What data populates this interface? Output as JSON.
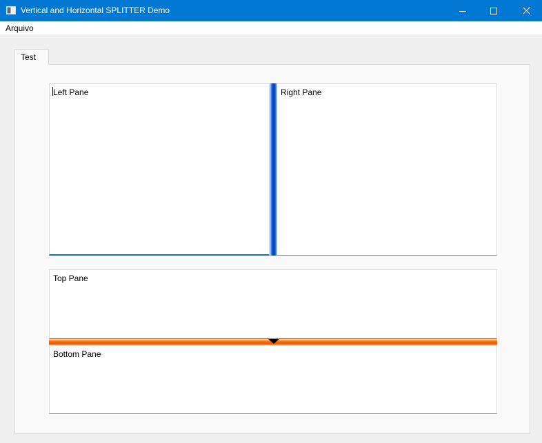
{
  "window": {
    "title": "Vertical and Horizontal SPLITTER Demo",
    "accent_color": "#0078d4",
    "controls": {
      "minimize_icon": "minimize-icon",
      "maximize_icon": "maximize-icon",
      "close_icon": "close-icon"
    }
  },
  "menubar": {
    "items": [
      {
        "label": "Arquivo"
      }
    ]
  },
  "tabs": [
    {
      "label": "Test",
      "selected": true
    }
  ],
  "panes": {
    "left": {
      "label": "Left Pane"
    },
    "right": {
      "label": "Right Pane"
    },
    "top": {
      "label": "Top Pane"
    },
    "bottom": {
      "label": "Bottom Pane"
    }
  },
  "splitters": {
    "vertical": {
      "color": "#0050c8"
    },
    "horizontal": {
      "color": "#ff7a1a"
    }
  }
}
